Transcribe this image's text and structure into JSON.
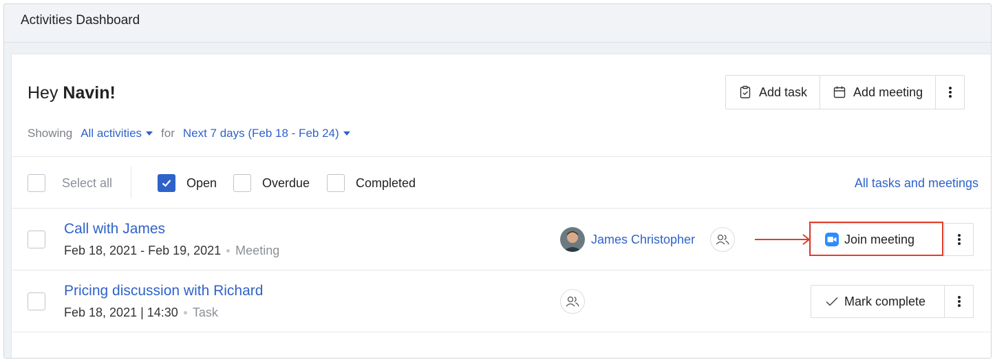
{
  "topbar": {
    "title": "Activities Dashboard"
  },
  "greeting": {
    "prefix": "Hey ",
    "name": "Navin!"
  },
  "actions": {
    "add_task": "Add task",
    "add_meeting": "Add meeting"
  },
  "filters": {
    "showing_label": "Showing",
    "activity_filter": "All activities",
    "for_label": "for",
    "date_filter": "Next 7 days (Feb 18 - Feb 24)"
  },
  "toolbar": {
    "select_all": "Select all",
    "open": "Open",
    "open_checked": true,
    "overdue": "Overdue",
    "completed": "Completed",
    "all_link": "All tasks and meetings"
  },
  "rows": [
    {
      "title": "Call with James",
      "date": "Feb 18, 2021 - Feb 19, 2021",
      "type": "Meeting",
      "person": "James Christopher",
      "action": "Join meeting"
    },
    {
      "title": "Pricing discussion with Richard",
      "date": "Feb 18, 2021 | 14:30",
      "type": "Task",
      "action": "Mark complete"
    }
  ],
  "colors": {
    "accent": "#2f62c9",
    "highlight": "#e53b26",
    "zoom": "#2d8cff"
  }
}
